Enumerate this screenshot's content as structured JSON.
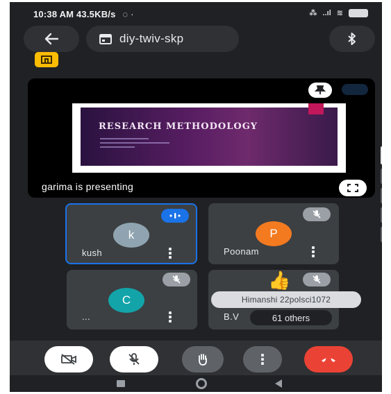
{
  "status_bar": {
    "time_speed": "10:38 AM  43.5KB/s",
    "signal_text": "..ıl",
    "battery_text": ""
  },
  "header": {
    "meeting_code": "diy-twiv-skp"
  },
  "presentation": {
    "slide_title": "RESEARCH METHODOLOGY",
    "presenting_text": "garima is presenting"
  },
  "participants": [
    {
      "initial": "k",
      "name": "kush",
      "color": "#8fa4b0",
      "speaking": true
    },
    {
      "initial": "P",
      "name": "Poonam",
      "color": "#f47a20",
      "muted": true
    },
    {
      "initial": "C",
      "name": "...",
      "color": "#12a4a9",
      "muted": true
    },
    {
      "initial": "",
      "name": "B.V",
      "muted": true
    }
  ],
  "reaction": {
    "emoji": "👍",
    "sender": "Himanshi 22polsci1072"
  },
  "others_label": "61 others",
  "colors": {
    "background": "#202124",
    "tile": "#3c4043",
    "accent_blue": "#1a73e8",
    "end_call_red": "#ea4335",
    "badge_yellow": "#fbbc04"
  },
  "icons": {
    "back": "arrow-left-icon",
    "calendar": "calendar-icon",
    "bluetooth": "bluetooth-icon",
    "pin": "pin-icon",
    "fullscreen": "fullscreen-icon",
    "camera_off": "camera-off-icon",
    "mic_off": "mic-off-icon",
    "raise_hand": "hand-icon",
    "more": "more-vert-icon",
    "end_call": "phone-hangup-icon"
  }
}
